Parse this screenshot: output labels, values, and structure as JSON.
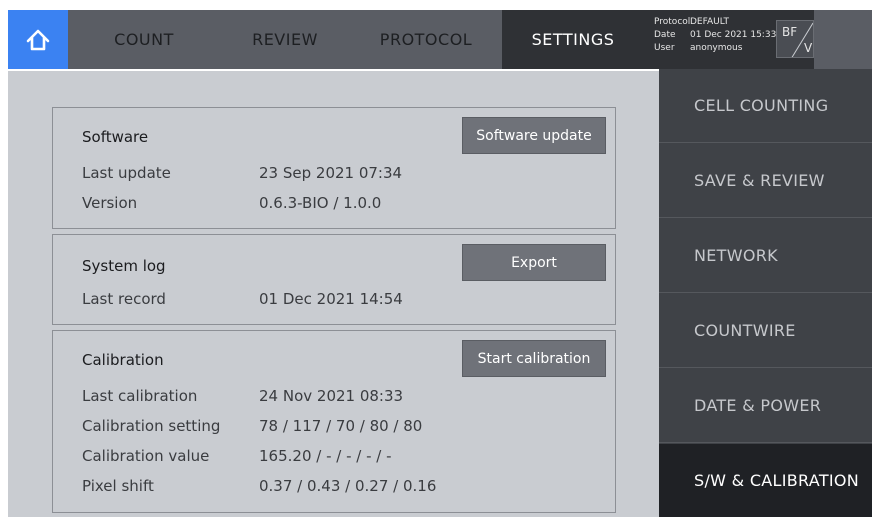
{
  "nav": {
    "tabs": [
      {
        "label": "COUNT"
      },
      {
        "label": "REVIEW"
      },
      {
        "label": "PROTOCOL"
      },
      {
        "label": "SETTINGS"
      }
    ],
    "active_tab": "SETTINGS"
  },
  "status": {
    "protocol_label": "Protocol",
    "protocol_value": "DEFAULT",
    "date_label": "Date",
    "date_value": "01 Dec 2021 15:33",
    "user_label": "User",
    "user_value": "anonymous",
    "mode_top": "BF",
    "mode_bottom": "V"
  },
  "software": {
    "title": "Software",
    "button": "Software update",
    "rows": [
      {
        "label": "Last update",
        "value": "23 Sep 2021 07:34"
      },
      {
        "label": "Version",
        "value": "0.6.3-BIO / 1.0.0"
      }
    ]
  },
  "syslog": {
    "title": "System log",
    "button": "Export",
    "rows": [
      {
        "label": "Last record",
        "value": "01 Dec 2021 14:54"
      }
    ]
  },
  "calibration": {
    "title": "Calibration",
    "button": "Start calibration",
    "rows": [
      {
        "label": "Last calibration",
        "value": "24 Nov 2021 08:33"
      },
      {
        "label": "Calibration setting",
        "value": "78 / 117 / 70 / 80 / 80"
      },
      {
        "label": "Calibration value",
        "value": "165.20 / - / - / - / -"
      },
      {
        "label": "Pixel shift",
        "value": "0.37 / 0.43 / 0.27 / 0.16"
      }
    ]
  },
  "sidebar": {
    "items": [
      {
        "label": "CELL COUNTING"
      },
      {
        "label": "SAVE & REVIEW"
      },
      {
        "label": "NETWORK"
      },
      {
        "label": "COUNTWIRE"
      },
      {
        "label": "DATE & POWER"
      },
      {
        "label": "S/W & CALIBRATION"
      }
    ],
    "active": "S/W & CALIBRATION"
  },
  "colors": {
    "accent": "#3b82f2",
    "topbar": "#5a5d64",
    "panel_bg": "#c9ccd1",
    "sidebar_bg": "#3f4247",
    "active_bg": "#1f2125"
  },
  "icons": {
    "home": "home-icon"
  }
}
